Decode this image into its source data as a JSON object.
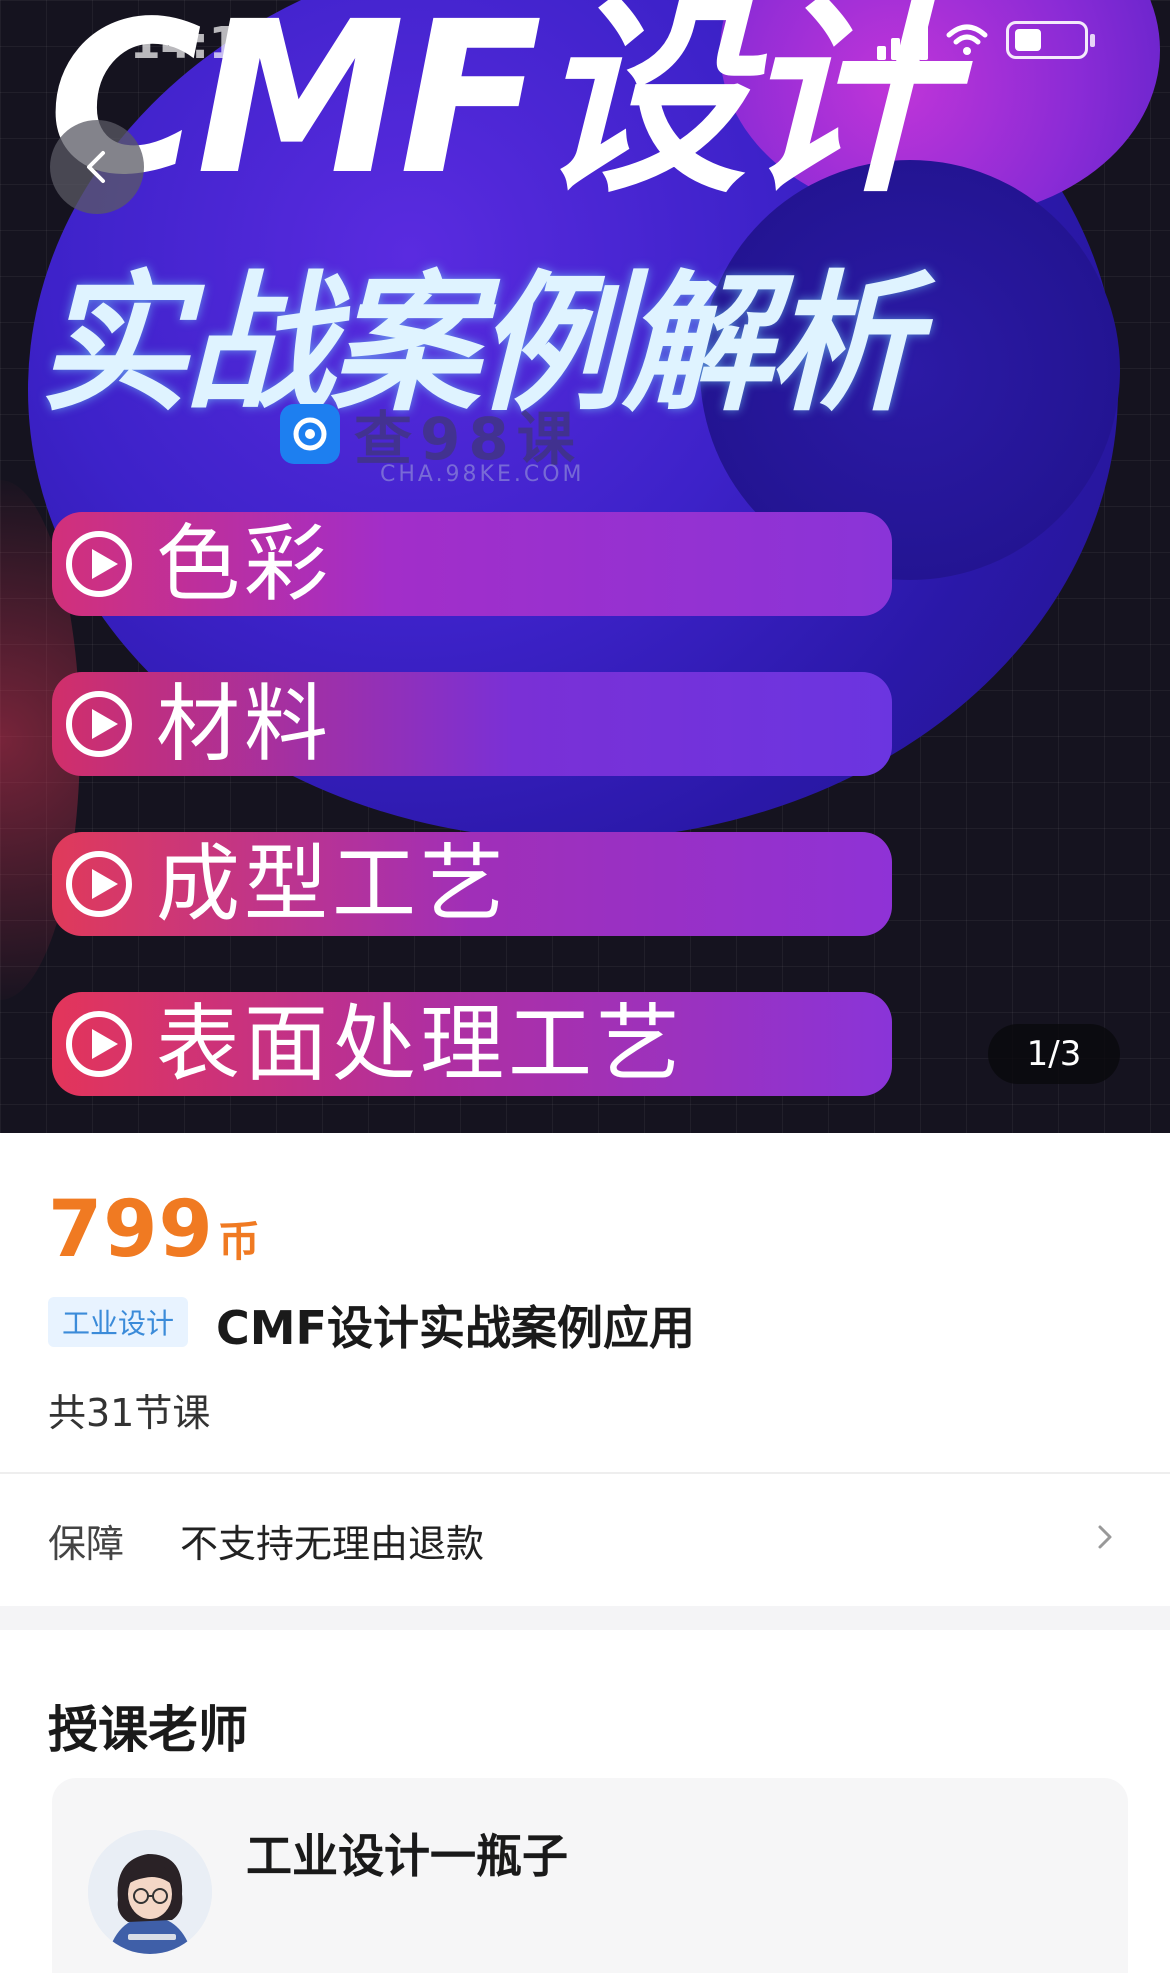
{
  "status_bar": {
    "time": "14:13"
  },
  "banner": {
    "title_line1": "CMF设计",
    "title_line2": "实战案例解析",
    "topics": [
      "色彩",
      "材料",
      "成型工艺",
      "表面处理工艺"
    ],
    "watermark_text": "查98课",
    "watermark_sub": "CHA.98KE.COM",
    "page_indicator": "1/3"
  },
  "course": {
    "price": "799",
    "price_unit": "币",
    "category_tag": "工业设计",
    "title": "CMF设计实战案例应用",
    "lesson_count": "共31节课"
  },
  "guarantee": {
    "label": "保障",
    "value": "不支持无理由退款"
  },
  "teacher": {
    "heading": "授课老师",
    "name": "工业设计一瓶子"
  },
  "colors": {
    "price": "#f07a22",
    "tag_bg": "#e8f3ff",
    "tag_text": "#3b8bd9",
    "banner_bg": "#15131f"
  },
  "icons": {
    "back": "chevron-left-icon",
    "chevron": "chevron-right-icon",
    "play": "play-circle-icon"
  }
}
